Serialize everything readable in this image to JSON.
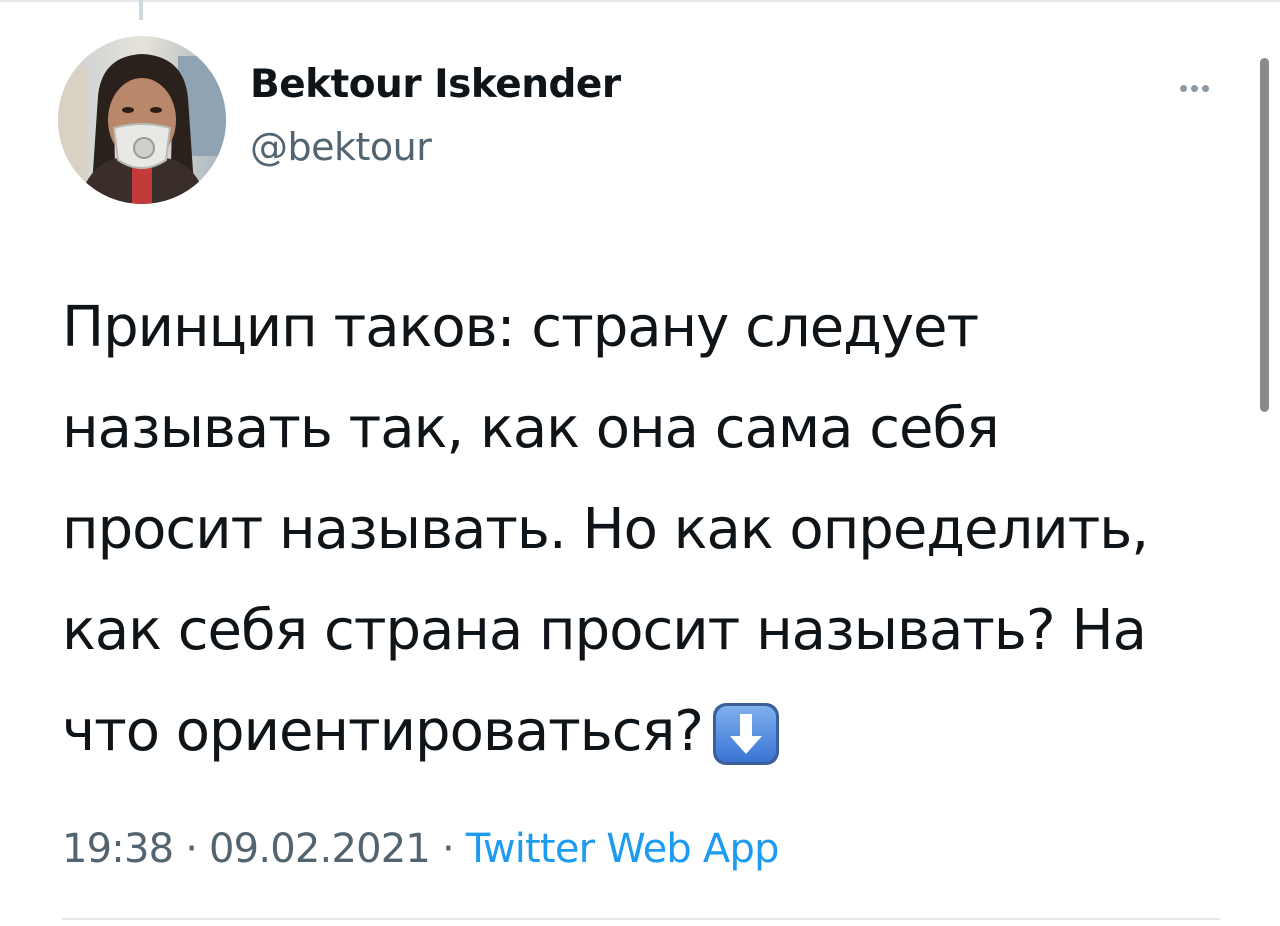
{
  "author": {
    "display_name": "Bektour Iskender",
    "handle": "@bektour",
    "avatar_icon": "avatar-photo"
  },
  "header": {
    "more_icon": "more-horizontal-icon"
  },
  "tweet": {
    "lines": [
      "Принцип таков: страну следует",
      "называть так, как она сама себя",
      "просит называть. Но как определить,",
      "как себя страна просит называть? На",
      "что ориентироваться?"
    ],
    "emoji": "down-arrow-emoji-icon"
  },
  "meta": {
    "time": "19:38",
    "separator_1": " · ",
    "date": "09.02.2021",
    "separator_2": " · ",
    "source": "Twitter Web App"
  },
  "colors": {
    "text": "#0f1419",
    "secondary": "#536471",
    "link": "#1d9bf0",
    "emoji_blue": "#5b8fe0"
  }
}
